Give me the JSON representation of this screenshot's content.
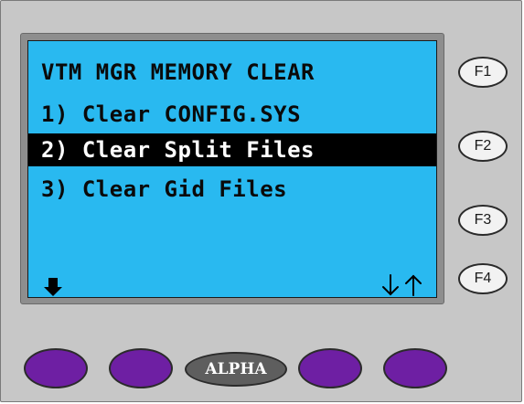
{
  "lcd": {
    "title": "VTM MGR MEMORY CLEAR",
    "items": [
      {
        "label": "1) Clear CONFIG.SYS",
        "selected": false
      },
      {
        "label": "2) Clear Split Files",
        "selected": true
      },
      {
        "label": "3) Clear Gid Files",
        "selected": false
      }
    ],
    "bottom_left_icon": "down-arrow-icon",
    "bottom_right_icons": [
      "arrow-down-icon",
      "arrow-up-icon"
    ]
  },
  "function_keys": [
    {
      "label": "F1"
    },
    {
      "label": "F2"
    },
    {
      "label": "F3"
    },
    {
      "label": "F4"
    }
  ],
  "soft_keys": {
    "alpha_label": "ALPHA"
  },
  "colors": {
    "lcd_background": "#29b9f0",
    "selection_background": "#000000",
    "soft_key": "#6e1fa3",
    "alpha_key": "#5e5e5e",
    "panel": "#c7c7c7"
  }
}
